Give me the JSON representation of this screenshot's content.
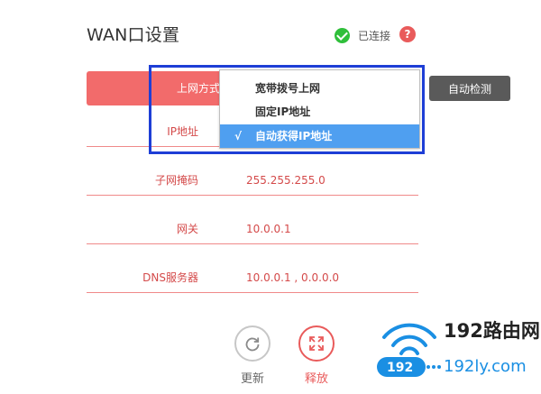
{
  "header": {
    "title": "WAN口设置",
    "status_text": "已连接",
    "help_glyph": "?"
  },
  "connection_type": {
    "label": "上网方式",
    "auto_detect_label": "自动检测",
    "dropdown": {
      "options": [
        "宽带拨号上网",
        "固定IP地址",
        "自动获得IP地址"
      ],
      "selected_index": 2,
      "check_glyph": "√"
    }
  },
  "fields": {
    "ip": {
      "label": "IP地址"
    },
    "subnet": {
      "label": "子网掩码",
      "value": "255.255.255.0"
    },
    "gateway": {
      "label": "网关",
      "value": "10.0.0.1"
    },
    "dns": {
      "label": "DNS服务器",
      "value": "10.0.0.1 , 0.0.0.0"
    }
  },
  "actions": {
    "refresh_label": "更新",
    "release_label": "释放"
  },
  "watermark": {
    "brand": "192路由网",
    "badge": "192",
    "domain": "192ly.com"
  },
  "colors": {
    "accent": "#f26b6b",
    "select_highlight": "#4f9ff0",
    "annotation_box": "#1e3ed6",
    "connected": "#2fbf3a"
  }
}
